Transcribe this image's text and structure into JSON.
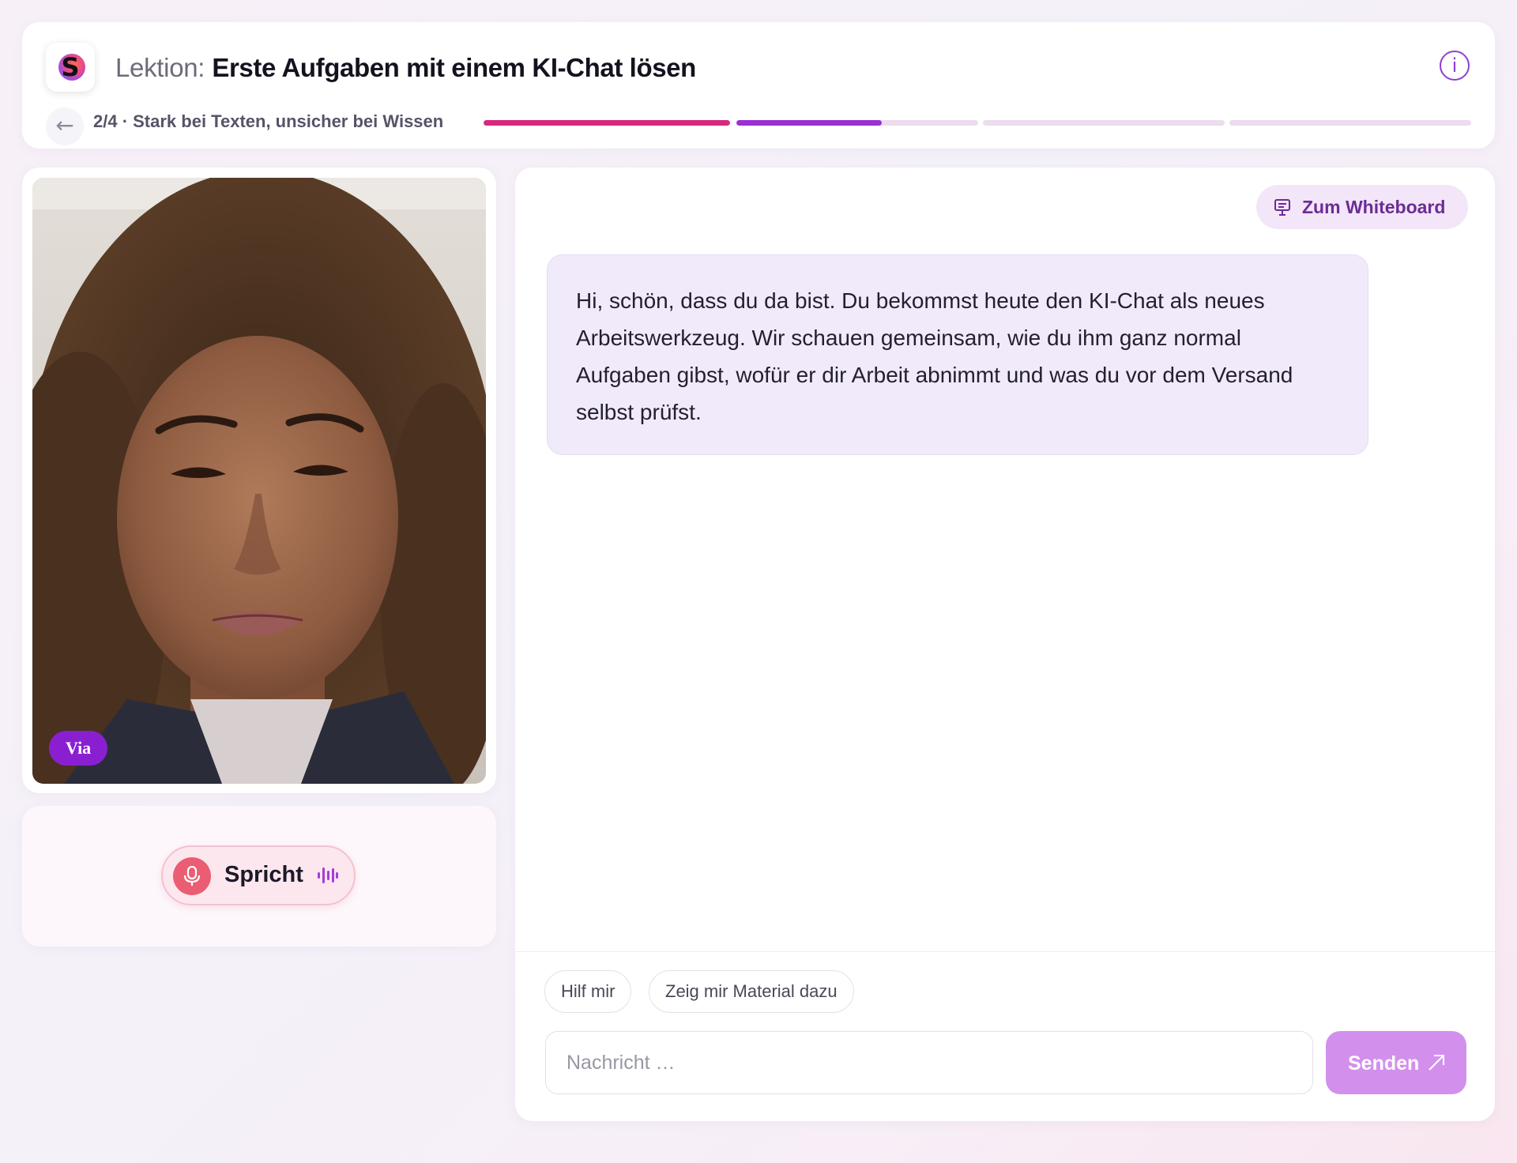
{
  "header": {
    "title_prefix": "Lektion:",
    "title": "Erste Aufgaben mit einem KI-Chat lösen",
    "info_icon_glyph": "i",
    "back_icon_glyph": "←",
    "step_label": "2/4 · Stark bei Texten, unsicher bei Wissen",
    "progress_segments": [
      {
        "fill": 1.0,
        "color": "#d6287f"
      },
      {
        "fill": 0.6,
        "color": "#9a30d6"
      },
      {
        "fill": 0.0,
        "color": "#ecdcef"
      },
      {
        "fill": 0.0,
        "color": "#ecdcef"
      }
    ],
    "logo_letter": "S"
  },
  "video": {
    "speaker_name": "Via"
  },
  "status": {
    "label": "Spricht",
    "mic_icon": "microphone-icon",
    "wave_icon": "audio-wave-icon"
  },
  "chat": {
    "whiteboard_button": "Zum Whiteboard",
    "whiteboard_icon": "presentation-board-icon",
    "message": "Hi, schön, dass du da bist. Du bekommst heute den KI-Chat als neues Arbeitswerkzeug. Wir schauen gemeinsam, wie du ihm ganz normal Aufgaben gibst, wofür er dir Arbeit abnimmt und was du vor dem Versand selbst prüfst.",
    "suggestions": [
      "Hilf mir",
      "Zeig mir Material dazu"
    ],
    "input_placeholder": "Nachricht …",
    "send_label": "Senden",
    "send_icon": "send-arrow-icon"
  },
  "colors": {
    "accent_purple": "#8d3fd6",
    "accent_pink": "#d6287f",
    "bubble_bg": "#f1eafa",
    "send_bg": "#d290ec"
  }
}
